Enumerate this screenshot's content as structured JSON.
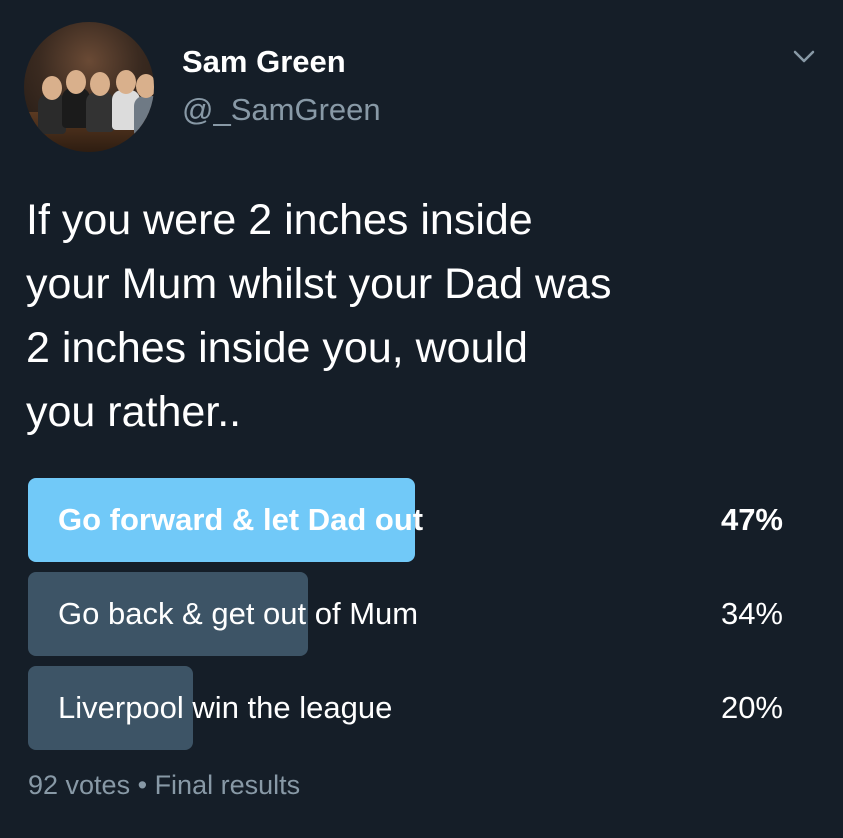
{
  "author": {
    "name": "Sam Green",
    "handle": "@_SamGreen"
  },
  "tweet": {
    "lines": [
      "If you were 2 inches inside",
      "your Mum whilst your Dad was",
      "2 inches inside you, would",
      "you rather.."
    ]
  },
  "poll": {
    "options": [
      {
        "label": "Go forward & let Dad out",
        "percent_text": "47%",
        "percent": 47,
        "winner": true
      },
      {
        "label": "Go back & get out of Mum",
        "percent_text": "34%",
        "percent": 34,
        "winner": false
      },
      {
        "label": "Liverpool win the league",
        "percent_text": "20%",
        "percent": 20,
        "winner": false
      }
    ],
    "votes": "92 votes",
    "separator": "•",
    "status": "Final results"
  },
  "colors": {
    "background": "#151e28",
    "winner_bar": "#71c9f8",
    "other_bar": "#3d5466",
    "secondary_text": "#8899a6"
  },
  "icons": {
    "menu": "chevron-down-icon",
    "avatar": "avatar"
  }
}
